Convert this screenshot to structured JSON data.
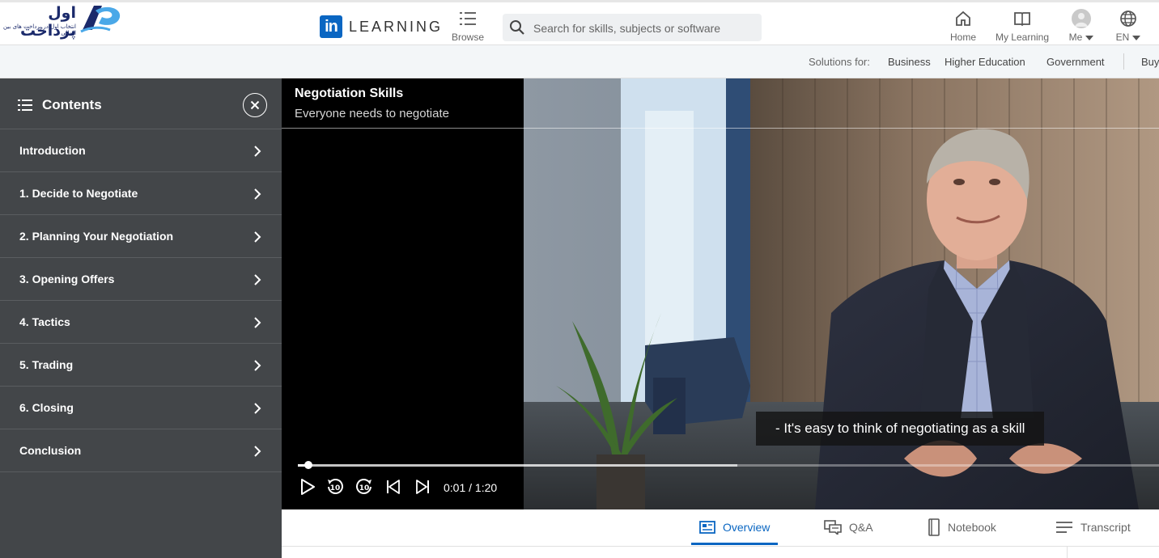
{
  "header": {
    "brand_name": "اول پرداخت",
    "brand_tagline": "انتخاب اول در پرداخت های بین المللی",
    "product_word": "LEARNING",
    "browse_label": "Browse",
    "search_placeholder": "Search for skills, subjects or software",
    "nav": {
      "home": "Home",
      "my_learning": "My Learning",
      "me": "Me",
      "language": "EN"
    }
  },
  "solutions": {
    "label": "Solutions for:",
    "links": [
      "Business",
      "Higher Education",
      "Government",
      "Buy"
    ]
  },
  "sidebar": {
    "title": "Contents",
    "items": [
      {
        "label": "Introduction"
      },
      {
        "label": "1. Decide to Negotiate"
      },
      {
        "label": "2. Planning Your Negotiation"
      },
      {
        "label": "3. Opening Offers"
      },
      {
        "label": "4. Tactics"
      },
      {
        "label": "5. Trading"
      },
      {
        "label": "6. Closing"
      },
      {
        "label": "Conclusion"
      }
    ]
  },
  "video": {
    "course_title": "Negotiation Skills",
    "video_title": "Everyone needs to negotiate",
    "caption": "- It's easy to think of negotiating as a skill",
    "time_display": "0:01 / 1:20",
    "progress_fraction": 0.0125,
    "buffer_fraction": 0.51
  },
  "tabs": [
    {
      "label": "Overview",
      "active": true
    },
    {
      "label": "Q&A",
      "active": false
    },
    {
      "label": "Notebook",
      "active": false
    },
    {
      "label": "Transcript",
      "active": false
    }
  ],
  "colors": {
    "linkedin_blue": "#0a66c2",
    "sidebar_bg": "#434649",
    "brand_navy": "#1b2a6b",
    "brand_light_blue": "#4aa8e8"
  }
}
